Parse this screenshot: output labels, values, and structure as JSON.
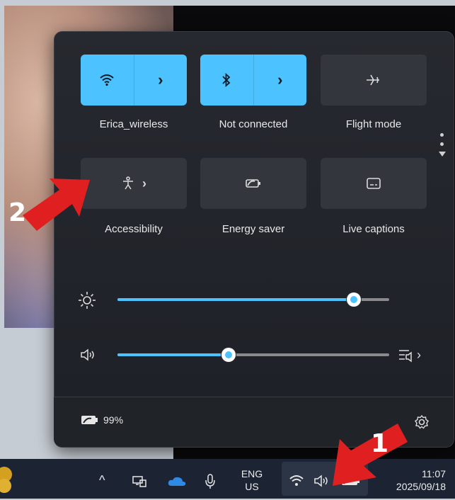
{
  "quick_settings": {
    "tiles_row1": [
      {
        "label": "Erica_wireless",
        "icon": "wifi-icon",
        "active": true,
        "has_chevron": true
      },
      {
        "label": "Not connected",
        "icon": "bluetooth-icon",
        "active": true,
        "has_chevron": true
      },
      {
        "label": "Flight mode",
        "icon": "airplane-icon",
        "active": false,
        "has_chevron": false
      }
    ],
    "tiles_row2": [
      {
        "label": "Accessibility",
        "icon": "accessibility-icon",
        "active": false,
        "has_chevron": true
      },
      {
        "label": "Energy saver",
        "icon": "energy-saver-icon",
        "active": false,
        "has_chevron": false
      },
      {
        "label": "Live captions",
        "icon": "captions-icon",
        "active": false,
        "has_chevron": false
      }
    ],
    "brightness_level": 0.87,
    "volume_level": 0.41,
    "battery_text": "99%",
    "accent_color": "#4cc2ff"
  },
  "taskbar": {
    "language_line1": "ENG",
    "language_line2": "US",
    "time": "11:07",
    "date": "2025/09/18"
  },
  "annotations": {
    "badge1": "1",
    "badge2": "2",
    "arrow_color": "#e02020"
  }
}
